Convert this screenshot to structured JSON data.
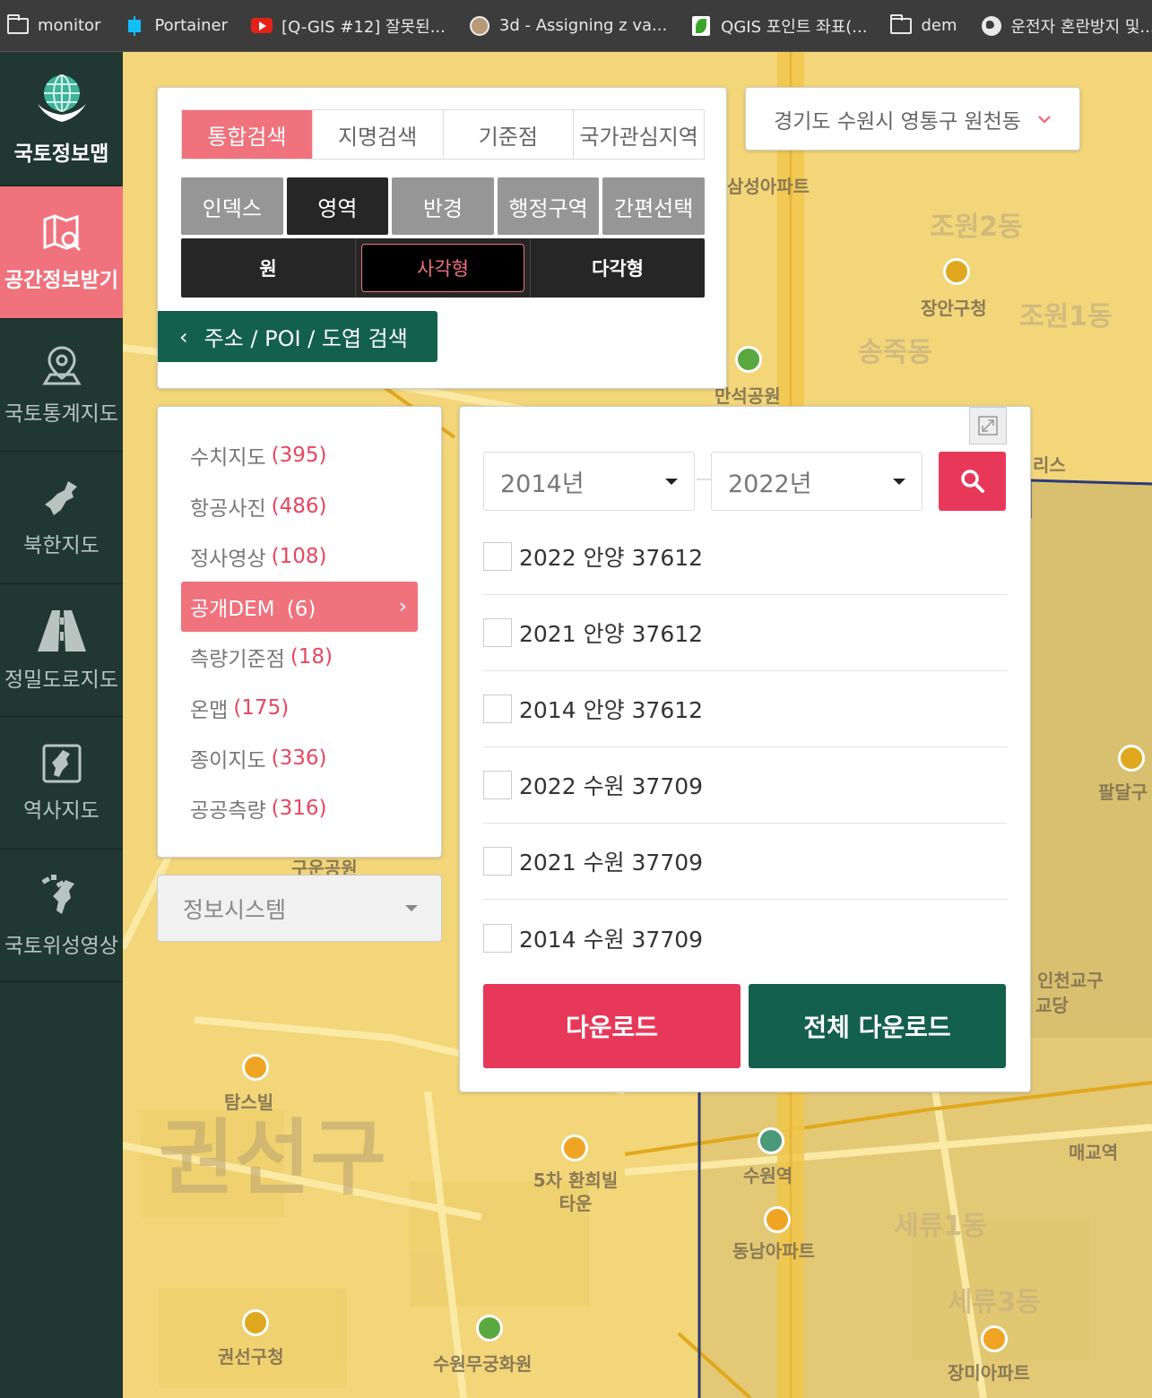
{
  "bookmarks": [
    {
      "label": "monitor",
      "icon": "folder-icon"
    },
    {
      "label": "Portainer",
      "icon": "portainer-icon"
    },
    {
      "label": "[Q-GIS #12] 잘못된...",
      "icon": "youtube-icon"
    },
    {
      "label": "3d - Assigning z va...",
      "icon": "site-icon"
    },
    {
      "label": "QGIS 포인트 좌표(...",
      "icon": "naver-icon"
    },
    {
      "label": "dem",
      "icon": "folder-icon"
    },
    {
      "label": "운전자 혼란방지 및...",
      "icon": "globe-icon"
    }
  ],
  "sidebar": {
    "logo_label": "국토정보맵",
    "items": [
      {
        "label": "공간정보받기",
        "icon": "map-search-icon",
        "active": true
      },
      {
        "label": "국토통계지도",
        "icon": "location-pin-icon",
        "active": false
      },
      {
        "label": "북한지도",
        "icon": "north-korea-icon",
        "active": false
      },
      {
        "label": "정밀도로지도",
        "icon": "road-icon",
        "active": false
      },
      {
        "label": "역사지도",
        "icon": "korea-frame-icon",
        "active": false
      },
      {
        "label": "국토위성영상",
        "icon": "satellite-korea-icon",
        "active": false
      }
    ]
  },
  "search": {
    "tabs": [
      "통합검색",
      "지명검색",
      "기준점",
      "국가관심지역"
    ],
    "active_tab": 0,
    "modes": [
      "인덱스",
      "영역",
      "반경",
      "행정구역",
      "간편선택"
    ],
    "active_mode": 1,
    "shapes": [
      "원",
      "사각형",
      "다각형"
    ],
    "active_shape": 1,
    "address_button": "주소 / POI / 도엽 검색"
  },
  "region_select": {
    "value": "경기도 수원시 영통구 원천동"
  },
  "categories": [
    {
      "label": "수치지도",
      "count": "(395)"
    },
    {
      "label": "항공사진",
      "count": "(486)"
    },
    {
      "label": "정사영상",
      "count": "(108)"
    },
    {
      "label": "공개DEM",
      "count": "(6)",
      "active": true
    },
    {
      "label": "측량기준점",
      "count": "(18)"
    },
    {
      "label": "온맵",
      "count": "(175)"
    },
    {
      "label": "종이지도",
      "count": "(336)"
    },
    {
      "label": "공공측량",
      "count": "(316)"
    }
  ],
  "system_select": {
    "value": "정보시스템"
  },
  "results": {
    "year_from": "2014년",
    "year_to": "2022년",
    "items": [
      {
        "label": "2022 안양 37612",
        "checked": false
      },
      {
        "label": "2021 안양 37612",
        "checked": false
      },
      {
        "label": "2014 안양 37612",
        "checked": false
      },
      {
        "label": "2022 수원 37709",
        "checked": false
      },
      {
        "label": "2021 수원 37709",
        "checked": false
      },
      {
        "label": "2014 수원 37709",
        "checked": false
      }
    ],
    "download_label": "다운로드",
    "download_all_label": "전체 다운로드"
  },
  "map_labels": {
    "district_big": "권선구",
    "samsung": "삼성아파트",
    "jowon2": "조원2동",
    "jowon1": "조원1동",
    "jangan_office": "장안구청",
    "songjuk": "송죽동",
    "manseok": "만석공원",
    "paldal": "팔달구",
    "incheon_church": "인천교구",
    "church": "교당",
    "tamsvil": "탐스빌",
    "hwanhui": "5차 환희빌타운",
    "suwon_station": "수원역",
    "maegyo": "매교역",
    "dongnam": "동남아파트",
    "sepryu1": "세류1동",
    "sepryu3": "세류3동",
    "gwonseon_office": "권선구청",
    "mugung": "수원무궁화원",
    "jangmi": "장미아파트",
    "gujun": "구운공원",
    "ris": "리스"
  },
  "colors": {
    "sidebar_bg": "#213832",
    "accent_pink": "#f0727d",
    "accent_red": "#e8385a",
    "accent_green": "#13604d",
    "map_yellow": "#f3d57a"
  }
}
